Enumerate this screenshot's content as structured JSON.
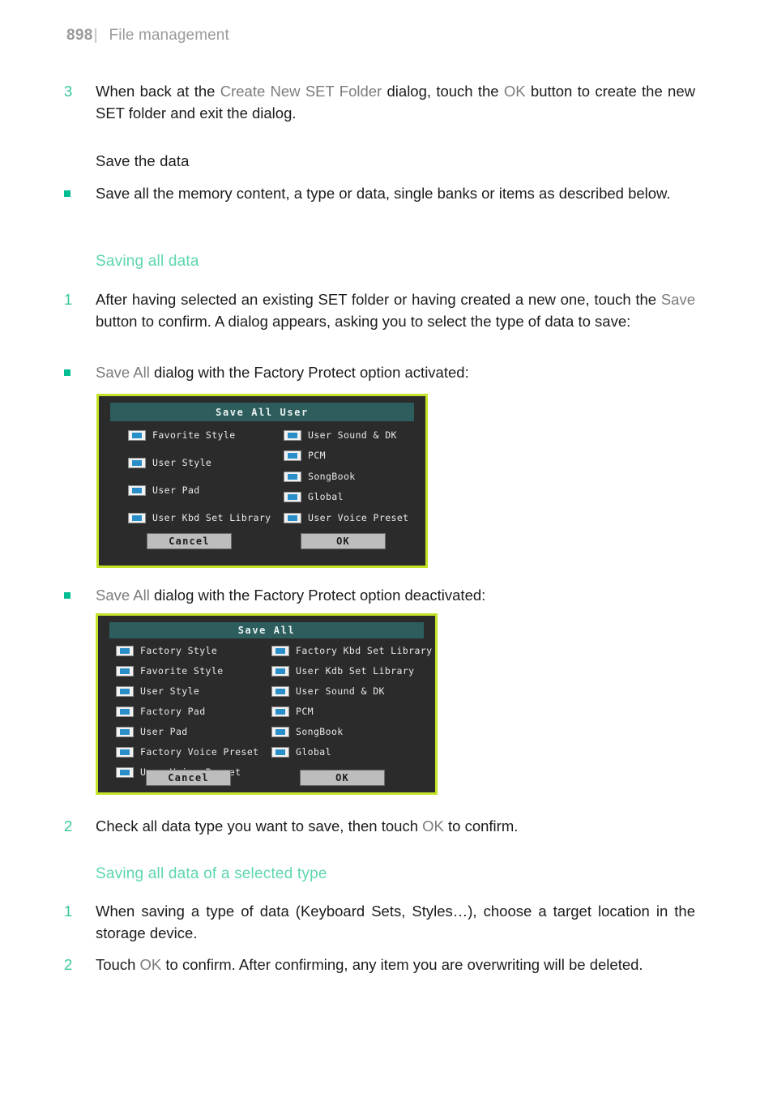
{
  "header": {
    "page_number": "898",
    "separator": "|",
    "title": "File management"
  },
  "body": {
    "step3_num": "3",
    "step3_pre": "When back at the ",
    "step3_dialog_name": "Create New SET Folder",
    "step3_mid": " dialog, touch the ",
    "step3_ok": "OK",
    "step3_post": " button to create the new SET folder and exit the dialog.",
    "save_the_data_heading": "Save the data",
    "save_the_data_bullet": "Save all the memory content, a type or data, single banks or items as described below.",
    "saving_all_data_heading": "Saving all data",
    "s1_num": "1",
    "s1_pre": "After having selected an existing SET folder or having created a new one, touch the ",
    "s1_save": "Save",
    "s1_post": " button to confirm. A dialog appears, asking you to select the type of data to save:",
    "bullet_activated_pre": "Save All",
    "bullet_activated_post": " dialog with the Factory Protect option activated:",
    "bullet_deactivated_pre": "Save All",
    "bullet_deactivated_post": " dialog with the Factory Protect option deactivated:",
    "s2_num": "2",
    "s2_pre": "Check all data type you want to save, then touch ",
    "s2_ok": "OK",
    "s2_post": " to confirm.",
    "saving_selected_type_heading": "Saving all data of a selected type",
    "t1_num": "1",
    "t1_text": "When saving a type of data (Keyboard Sets, Styles…), choose a target location in the storage device.",
    "t2_num": "2",
    "t2_pre": "Touch ",
    "t2_ok": "OK",
    "t2_post": " to confirm. After confirming, any item you are overwriting will be deleted."
  },
  "dialog_save_all_user": {
    "title": "Save All User",
    "left_column": [
      {
        "label": "Favorite Style",
        "checked": true
      },
      {
        "label": "User Style",
        "checked": true
      },
      {
        "label": "User Pad",
        "checked": true
      },
      {
        "label": "User Kbd Set Library",
        "checked": true
      }
    ],
    "right_column": [
      {
        "label": "User Sound & DK",
        "checked": true
      },
      {
        "label": "PCM",
        "checked": true
      },
      {
        "label": "SongBook",
        "checked": true
      },
      {
        "label": "Global",
        "checked": true
      },
      {
        "label": "User Voice Preset",
        "checked": true
      }
    ],
    "cancel_label": "Cancel",
    "ok_label": "OK"
  },
  "dialog_save_all": {
    "title": "Save All",
    "left_column": [
      {
        "label": "Factory Style",
        "checked": true
      },
      {
        "label": "Favorite Style",
        "checked": true
      },
      {
        "label": "User Style",
        "checked": true
      },
      {
        "label": "Factory Pad",
        "checked": true
      },
      {
        "label": "User Pad",
        "checked": true
      },
      {
        "label": "Factory Voice Preset",
        "checked": true
      },
      {
        "label": "User Voice Preset",
        "checked": true
      }
    ],
    "right_column": [
      {
        "label": "Factory Kbd Set Library",
        "checked": true
      },
      {
        "label": "User Kdb Set Library",
        "checked": true
      },
      {
        "label": "User Sound & DK",
        "checked": true
      },
      {
        "label": "PCM",
        "checked": true
      },
      {
        "label": "SongBook",
        "checked": true
      },
      {
        "label": "Global",
        "checked": true
      }
    ],
    "cancel_label": "Cancel",
    "ok_label": "OK"
  },
  "colors": {
    "accent_teal": "#36c79b",
    "heading_mint": "#5ed7ae",
    "bullet_square": "#00bd93",
    "dialog_border": "#c5e228",
    "dialog_titlebar": "#2d5d5d",
    "dialog_body": "#2b2b2b",
    "checkbox_fill": "#2a8fc9",
    "button_face": "#bdbdbd",
    "header_gray": "#9b9b9b"
  }
}
